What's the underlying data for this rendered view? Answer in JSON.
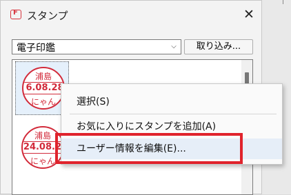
{
  "window": {
    "title": "スタンプ",
    "close_glyph": "✕"
  },
  "toolbar": {
    "select_value": "電子印鑑",
    "select_chevron": "⌵",
    "import_label": "取り込み..."
  },
  "stamps": [
    {
      "name": "浦島",
      "date": "6.08.28",
      "nick": "にゃん",
      "selected": true
    },
    {
      "name": "浦島",
      "date": "'24.08.28",
      "nick": "にゃん",
      "selected": false
    }
  ],
  "context_menu": {
    "items": [
      {
        "label": "選択(S)"
      },
      {
        "label": "お気に入りにスタンプを追加(A)"
      },
      {
        "label": "ユーザー情報を編集(E)..."
      }
    ]
  },
  "colors": {
    "stamp_red": "#d22a3a",
    "highlight_box": "#e0232c"
  }
}
